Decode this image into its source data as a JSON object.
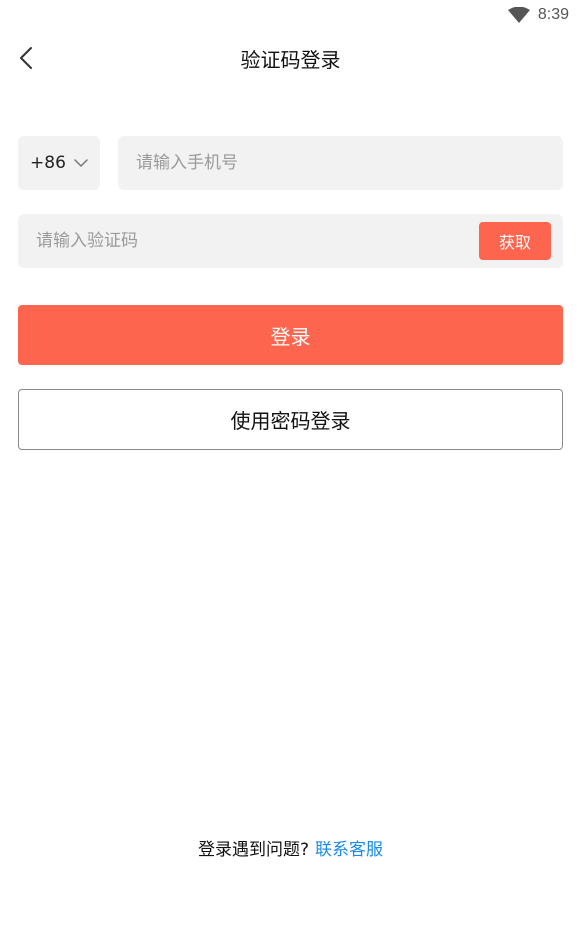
{
  "status_bar": {
    "time": "8:39",
    "wifi_icon": "wifi-icon"
  },
  "nav": {
    "title": "验证码登录",
    "back_icon": "chevron-left-icon"
  },
  "phone": {
    "country_code": "+86",
    "placeholder": "请输入手机号",
    "value": ""
  },
  "code": {
    "placeholder": "请输入验证码",
    "value": "",
    "get_code_label": "获取"
  },
  "actions": {
    "login_label": "登录",
    "password_login_label": "使用密码登录"
  },
  "footer": {
    "help_text": "登录遇到问题?",
    "support_link": "联系客服"
  },
  "colors": {
    "accent": "#fe654e",
    "link": "#1a8be8",
    "field_bg": "#f2f2f2"
  }
}
